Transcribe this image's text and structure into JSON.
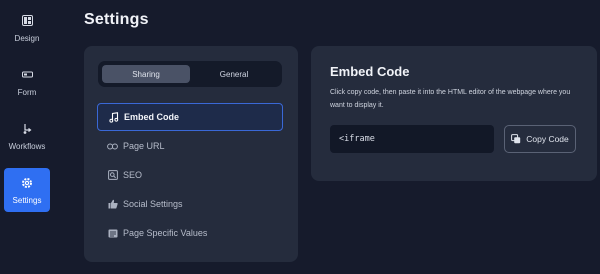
{
  "rail": {
    "items": [
      {
        "label": "Design",
        "icon": "design-icon"
      },
      {
        "label": "Form",
        "icon": "form-icon"
      },
      {
        "label": "Workflows",
        "icon": "workflow-icon"
      },
      {
        "label": "Settings",
        "icon": "gear-icon",
        "active": true
      }
    ]
  },
  "header": {
    "title": "Settings"
  },
  "tabs": [
    {
      "label": "Sharing",
      "active": true
    },
    {
      "label": "General",
      "active": false
    }
  ],
  "menu": {
    "items": [
      {
        "label": "Embed Code",
        "icon": "music-note-icon",
        "active": true
      },
      {
        "label": "Page URL",
        "icon": "link-icon"
      },
      {
        "label": "SEO",
        "icon": "seo-icon"
      },
      {
        "label": "Social Settings",
        "icon": "thumbs-up-icon"
      },
      {
        "label": "Page Specific Values",
        "icon": "page-values-icon"
      }
    ]
  },
  "embed": {
    "title": "Embed Code",
    "description": "Click copy code, then paste it into the HTML editor of the webpage where you want to display it.",
    "code": "<iframe",
    "copy_label": "Copy Code"
  },
  "colors": {
    "background": "#161b2c",
    "card": "#252c3d",
    "accent": "#2f6ff2",
    "active_border": "#3a68d6"
  }
}
